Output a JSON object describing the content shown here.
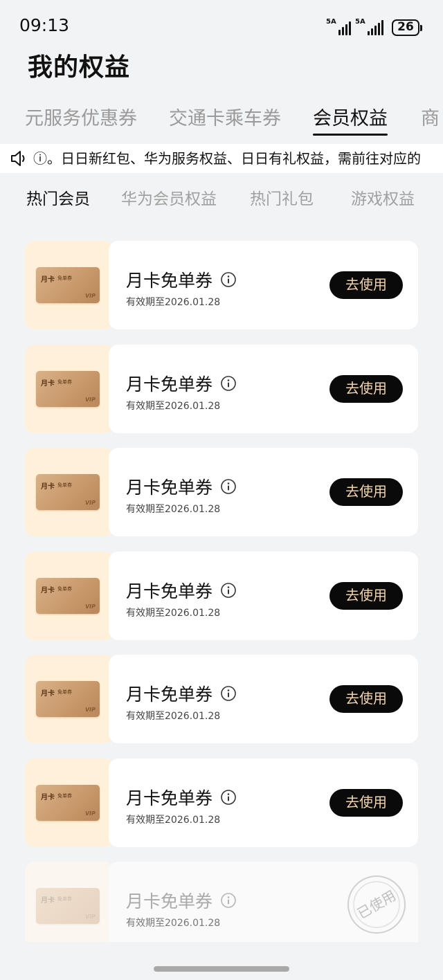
{
  "status": {
    "time": "09:13",
    "network1": "5A",
    "network2": "5A",
    "battery": "26"
  },
  "page_title": "我的权益",
  "tabs": [
    "元服务优惠券",
    "交通卡乘车券",
    "会员权益",
    "商"
  ],
  "notice": "ⓘ。日日新红包、华为服务权益、日日有礼权益，需前往对应的",
  "subtabs": [
    "热门会员",
    "华为会员权益",
    "热门礼包",
    "游戏权益"
  ],
  "card_art": {
    "title": "月卡",
    "subtitle": "免单券",
    "badge": "VIP"
  },
  "coupons": [
    {
      "name": "月卡免单券",
      "expire": "有效期至2026.01.28",
      "action": "去使用"
    },
    {
      "name": "月卡免单券",
      "expire": "有效期至2026.01.28",
      "action": "去使用"
    },
    {
      "name": "月卡免单券",
      "expire": "有效期至2026.01.28",
      "action": "去使用"
    },
    {
      "name": "月卡免单券",
      "expire": "有效期至2026.01.28",
      "action": "去使用"
    },
    {
      "name": "月卡免单券",
      "expire": "有效期至2026.01.28",
      "action": "去使用"
    },
    {
      "name": "月卡免单券",
      "expire": "有效期至2026.01.28",
      "action": "去使用"
    },
    {
      "name": "月卡免单券",
      "expire": "有效期至2026.01.28",
      "action": "已使用"
    }
  ],
  "colors": {
    "button_bg": "#0a0a0a",
    "button_text": "#f2d3ad",
    "thumb_bg": "#fff0d9",
    "page_bg": "#f2f3f5"
  }
}
